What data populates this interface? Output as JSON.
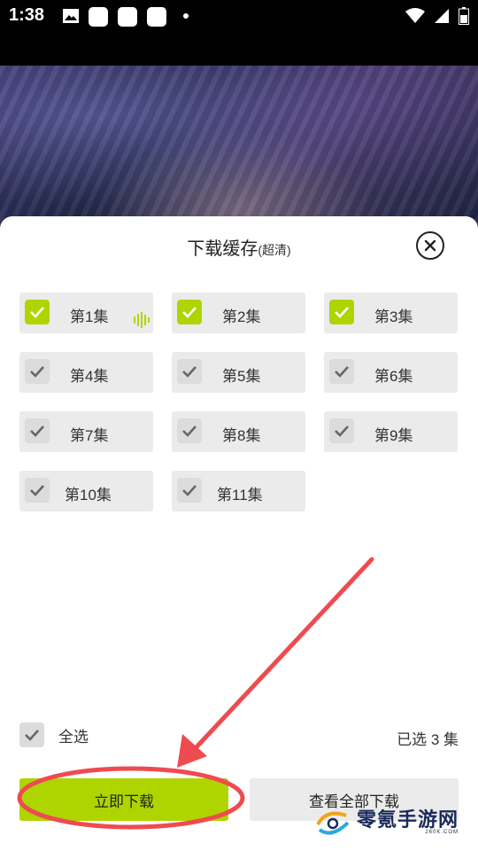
{
  "status_bar": {
    "time": "1:38"
  },
  "sheet": {
    "title": "下载缓存",
    "subtitle": "(超清)",
    "episodes": [
      {
        "label": "第1集",
        "selected": true,
        "downloading": true
      },
      {
        "label": "第2集",
        "selected": true
      },
      {
        "label": "第3集",
        "selected": true
      },
      {
        "label": "第4集",
        "selected": false
      },
      {
        "label": "第5集",
        "selected": false
      },
      {
        "label": "第6集",
        "selected": false
      },
      {
        "label": "第7集",
        "selected": false
      },
      {
        "label": "第8集",
        "selected": false
      },
      {
        "label": "第9集",
        "selected": false
      },
      {
        "label": "第10集",
        "selected": false
      },
      {
        "label": "第11集",
        "selected": false
      }
    ],
    "select_all_label": "全选",
    "selected_count": "已选 3 集",
    "download_button": "立即下载",
    "view_all_button": "查看全部下载"
  },
  "watermark": {
    "text": "零氪手游网",
    "sub": "260K.COM"
  },
  "colors": {
    "accent": "#aed500",
    "annotation": "#ee4b50"
  }
}
